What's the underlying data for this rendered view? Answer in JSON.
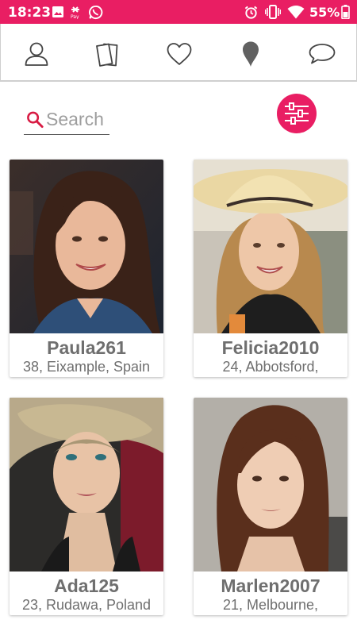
{
  "status_bar": {
    "time": "18:23",
    "battery": "55%",
    "background_color": "#e91e63",
    "left_icons": [
      "image-icon",
      "pay-icon",
      "whatsapp-icon"
    ],
    "right_icons": [
      "alarm-icon",
      "vibrate-icon",
      "wifi-icon",
      "battery-icon"
    ]
  },
  "nav": {
    "items": [
      "profile-icon",
      "cards-icon",
      "favorites-heart-icon",
      "location-pin-icon",
      "messages-chat-icon"
    ]
  },
  "search": {
    "placeholder": "Search",
    "value": ""
  },
  "accent_color": "#e91e63",
  "profiles": [
    {
      "name": "Paula261",
      "details": "38, Eixample, Spain",
      "photo": "portrait-brunette-smiling"
    },
    {
      "name": "Felicia2010",
      "details": "24, Abbotsford,",
      "photo": "portrait-straw-hat-smiling"
    },
    {
      "name": "Ada125",
      "details": "23, Rudawa, Poland",
      "photo": "portrait-blonde-lying"
    },
    {
      "name": "Marlen2007",
      "details": "21, Melbourne,",
      "photo": "portrait-auburn-neutral"
    }
  ]
}
